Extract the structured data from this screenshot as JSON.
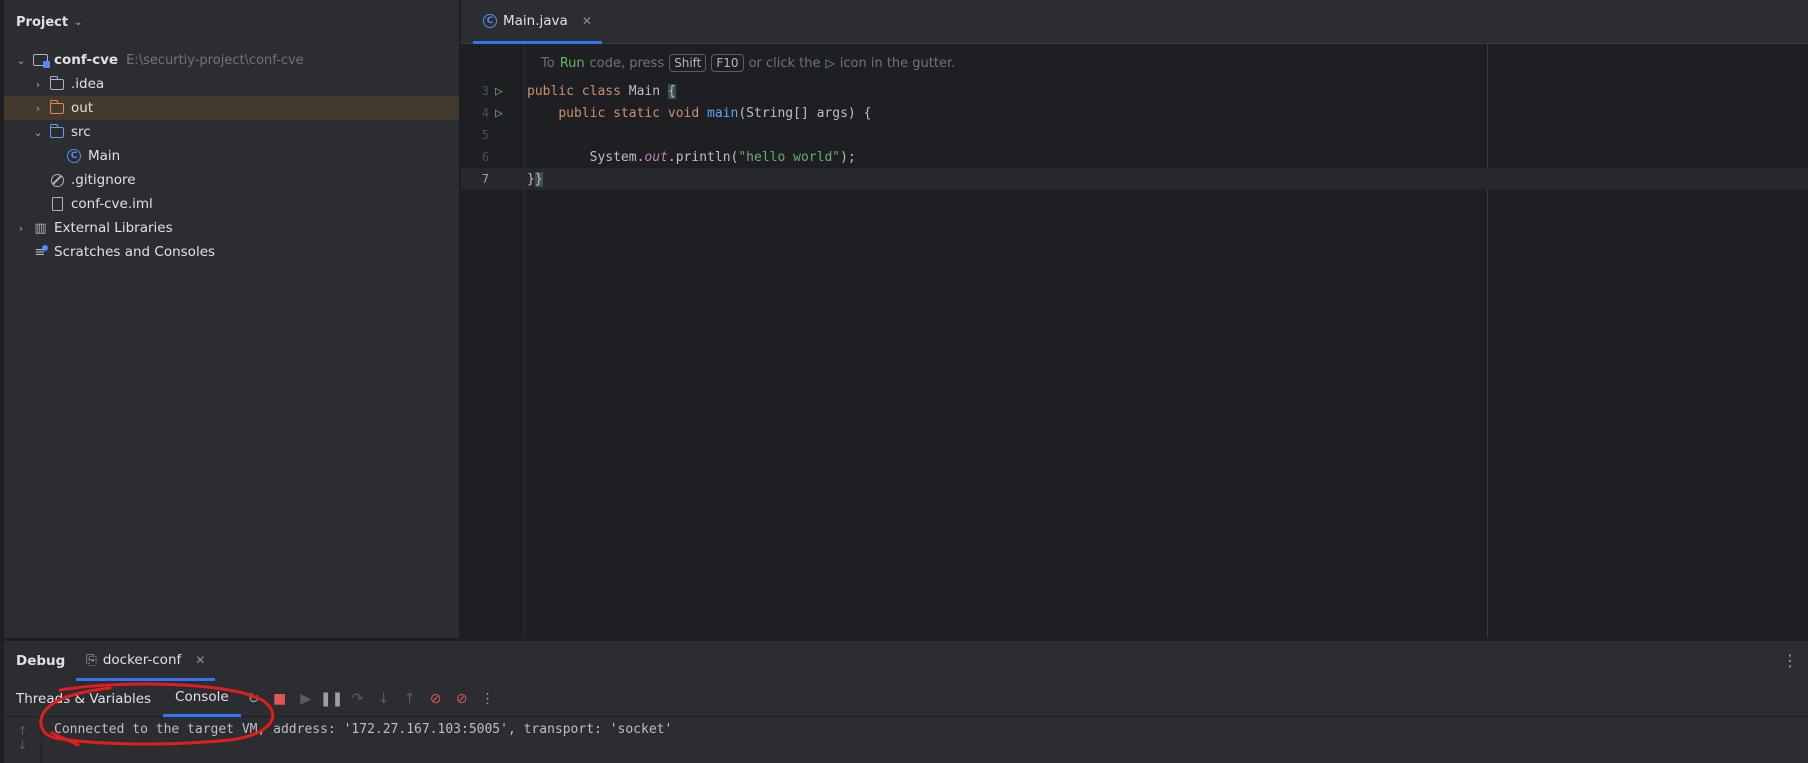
{
  "project_panel": {
    "title": "Project",
    "tree": [
      {
        "label": "conf-cve",
        "path": "E:\\securtiy-project\\conf-cve",
        "icon": "project-folder-icon",
        "expanded": true
      },
      {
        "label": ".idea",
        "icon": "folder-icon",
        "expanded": false
      },
      {
        "label": "out",
        "icon": "folder-excluded-icon",
        "expanded": false,
        "selected": true
      },
      {
        "label": "src",
        "icon": "source-folder-icon",
        "expanded": true
      },
      {
        "label": "Main",
        "icon": "java-class-icon"
      },
      {
        "label": ".gitignore",
        "icon": "ignored-file-icon"
      },
      {
        "label": "conf-cve.iml",
        "icon": "module-file-icon"
      },
      {
        "label": "External Libraries",
        "icon": "library-icon",
        "expanded": false
      },
      {
        "label": "Scratches and Consoles",
        "icon": "scratches-icon"
      }
    ]
  },
  "editor": {
    "tab_label": "Main.java",
    "hint": {
      "prefix": "To",
      "run": "Run",
      "middle": "code, press",
      "key1": "Shift",
      "key2": "F10",
      "after_keys": "or click the",
      "suffix": "icon in the gutter."
    },
    "line_numbers": [
      "3",
      "4",
      "5",
      "6",
      "7"
    ],
    "code": {
      "l3_kw": "public class",
      "l3_name": " Main ",
      "l3_brace": "{",
      "l4_kw": "public static void",
      "l4_fn": "main",
      "l4_rest": "(String[] args) {",
      "l6_pre": "System.",
      "l6_field": "out",
      "l6_mid": ".println(",
      "l6_str": "\"hello world\"",
      "l6_end": ");",
      "l7_close1": "}",
      "l7_close2": "}"
    }
  },
  "debug_panel": {
    "title": "Debug",
    "session_label": "docker-conf",
    "tabs": [
      "Threads & Variables",
      "Console"
    ],
    "active_tab": "Console",
    "console_output": "Connected to the target VM, address: '172.27.167.103:5005', transport: 'socket'"
  },
  "colors": {
    "accent": "#3574f0",
    "annotation": "#e11d1d",
    "run_green": "#5fb865"
  }
}
